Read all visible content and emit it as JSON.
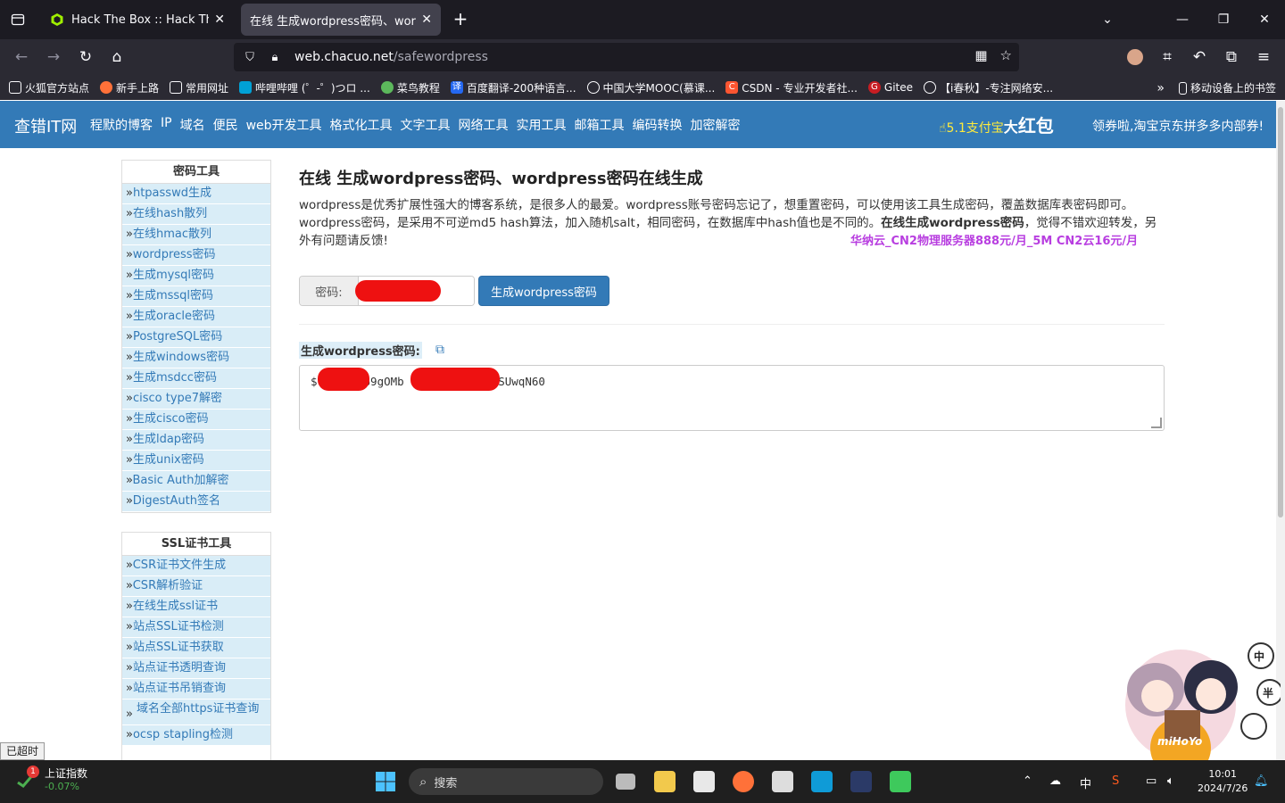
{
  "browser": {
    "tabs": [
      {
        "title": "Hack The Box :: Hack The Box"
      },
      {
        "title": "在线 生成wordpress密码、wordpre"
      }
    ],
    "url_host": "web.chacuo.net",
    "url_path": "/safewordpress",
    "bookmarks": [
      "火狐官方站点",
      "新手上路",
      "常用网址",
      "哔哩哔哩 (゜-゜)つロ ...",
      "菜鸟教程",
      "百度翻译-200种语言...",
      "中国大学MOOC(慕课...",
      "CSDN - 专业开发者社...",
      "Gitee",
      "【i春秋】-专注网络安..."
    ],
    "mobile_bookmarks": "移动设备上的书签"
  },
  "site": {
    "logo": "查错IT网",
    "nav": [
      "程默的博客",
      "IP",
      "域名",
      "便民",
      "web开发工具",
      "格式化工具",
      "文字工具",
      "网络工具",
      "实用工具",
      "邮箱工具",
      "编码转换",
      "加密解密"
    ],
    "promo_small": "5.1支付宝",
    "promo_big_prefix": "大",
    "promo_big": "红包",
    "promo_right": "领券啦,淘宝京东拼多多内部券!"
  },
  "sidebar": {
    "panel1_title": "密码工具",
    "panel1_items": [
      "htpasswd生成",
      "在线hash散列",
      "在线hmac散列",
      "wordpress密码",
      "生成mysql密码",
      "生成mssql密码",
      "生成oracle密码",
      "PostgreSQL密码",
      "生成windows密码",
      "生成msdcc密码",
      "cisco type7解密",
      "生成cisco密码",
      "生成ldap密码",
      "生成unix密码",
      "Basic Auth加解密",
      "DigestAuth签名"
    ],
    "panel2_title": "SSL证书工具",
    "panel2_items": [
      "CSR证书文件生成",
      "CSR解析验证",
      "在线生成ssl证书",
      "站点SSL证书检测",
      "站点SSL证书获取",
      "站点证书透明查询",
      "站点证书吊销查询",
      "域名全部https证书查询",
      "ocsp stapling检测"
    ]
  },
  "main": {
    "title": "在线 生成wordpress密码、wordpress密码在线生成",
    "desc_part1": "wordpress是优秀扩展性强大的博客系统，是很多人的最爱。wordpress账号密码忘记了，想重置密码，可以使用该工具生成密码，覆盖数据库表密码即可。wordpress密码，是采用不可逆md5 hash算法，加入随机salt，相同密码，在数据库中hash值也是不同的。",
    "desc_bold": "在线生成wordpress密码",
    "desc_part2": "，觉得不错欢迎转发，另外有问题请反馈!",
    "ad": "华纳云_CN2物理服务器888元/月_5M CN2云16元/月",
    "password_label": "密码:",
    "generate_button": "生成wordpress密码",
    "result_label": "生成wordpress密码:",
    "result_frag1": "$",
    "result_frag2": "69gOMb",
    "result_frag3": "lSUwqN60"
  },
  "status": {
    "timeout": "已超时"
  },
  "taskbar": {
    "stock_name": "上证指数",
    "stock_change": "-0.07%",
    "stock_badge": "1",
    "search": "搜索",
    "ime": "中",
    "time": "10:01",
    "date": "2024/7/26"
  },
  "mascot": {
    "brand": "miHoYo",
    "bubbles": [
      "中",
      "半"
    ]
  },
  "colors": {
    "site_blue": "#337ab7",
    "side_bg": "#d9edf7",
    "ad_purple": "#b83ee0",
    "redaction": "#ee1111"
  }
}
